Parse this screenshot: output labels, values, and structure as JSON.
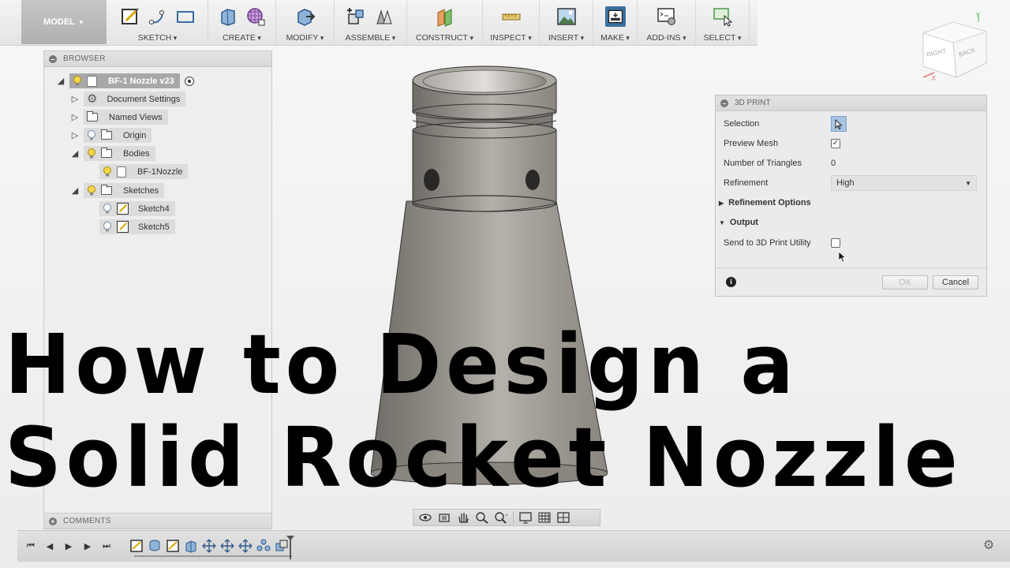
{
  "toolbar": {
    "workspace": "MODEL",
    "groups": [
      {
        "label": "SKETCH"
      },
      {
        "label": "CREATE"
      },
      {
        "label": "MODIFY"
      },
      {
        "label": "ASSEMBLE"
      },
      {
        "label": "CONSTRUCT"
      },
      {
        "label": "INSPECT"
      },
      {
        "label": "INSERT"
      },
      {
        "label": "MAKE"
      },
      {
        "label": "ADD-INS"
      },
      {
        "label": "SELECT"
      }
    ]
  },
  "browser": {
    "title": "BROWSER",
    "root": "BF-1 Nozzle v23",
    "items": [
      {
        "label": "Document Settings"
      },
      {
        "label": "Named Views"
      },
      {
        "label": "Origin"
      },
      {
        "label": "Bodies"
      },
      {
        "label": "BF-1Nozzle"
      },
      {
        "label": "Sketches"
      },
      {
        "label": "Sketch4"
      },
      {
        "label": "Sketch5"
      }
    ],
    "comments": "COMMENTS"
  },
  "viewcube": {
    "faces": [
      "RIGHT",
      "BACK"
    ],
    "axes": [
      "X",
      "Y"
    ]
  },
  "print_dialog": {
    "title": "3D PRINT",
    "selection_label": "Selection",
    "preview_mesh_label": "Preview Mesh",
    "preview_mesh_checked": true,
    "triangles_label": "Number of Triangles",
    "triangles_value": "0",
    "refinement_label": "Refinement",
    "refinement_value": "High",
    "refinement_options_label": "Refinement Options",
    "output_label": "Output",
    "send_label": "Send to 3D Print Utility",
    "send_checked": false,
    "ok_label": "OK",
    "cancel_label": "Cancel"
  },
  "title": {
    "line1": "How to Design a",
    "line2": "Solid Rocket Nozzle"
  }
}
